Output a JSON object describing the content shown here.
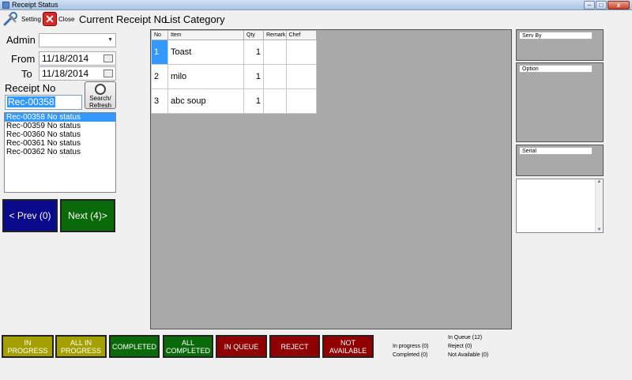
{
  "window": {
    "title": "Receipt Status"
  },
  "toolbar": {
    "setting_label": "Setting",
    "close_label": "Close",
    "current_receipt_label": "Current Receipt No",
    "list_category_label": "List Category"
  },
  "filter": {
    "admin_label": "Admin",
    "admin_value": "",
    "from_label": "From",
    "from_value": "11/18/2014",
    "to_label": "To",
    "to_value": "11/18/2014",
    "receipt_no_label": "Receipt No",
    "receipt_no_value": "Rec-00358",
    "search_label_1": "Search/",
    "search_label_2": "Refresh"
  },
  "receipts": [
    {
      "text": "Rec-00358 No status",
      "selected": true
    },
    {
      "text": "Rec-00359 No status",
      "selected": false
    },
    {
      "text": "Rec-00360 No status",
      "selected": false
    },
    {
      "text": "Rec-00361 No status",
      "selected": false
    },
    {
      "text": "Rec-00362 No status",
      "selected": false
    }
  ],
  "nav": {
    "prev_label": "< Prev (0)",
    "next_label": "Next (4)>"
  },
  "table": {
    "columns": [
      "No",
      "Item",
      "Qty",
      "Remark",
      "Chef"
    ],
    "rows": [
      {
        "no": "1",
        "item": "Toast",
        "qty": "1",
        "remark": "",
        "chef": ""
      },
      {
        "no": "2",
        "item": "milo",
        "qty": "1",
        "remark": "",
        "chef": ""
      },
      {
        "no": "3",
        "item": "abc soup",
        "qty": "1",
        "remark": "",
        "chef": ""
      }
    ]
  },
  "side": {
    "serv_by_label": "Serv By",
    "option_label": "Option",
    "serial_label": "Serial"
  },
  "status_buttons": {
    "in_progress": "IN PROGRESS",
    "all_in_progress_1": "ALL IN",
    "all_in_progress_2": "PROGRESS",
    "completed": "COMPLETED",
    "all_completed_1": "ALL",
    "all_completed_2": "COMPLETED",
    "in_queue": "IN QUEUE",
    "reject": "REJECT",
    "not_available_1": "NOT",
    "not_available_2": "AVAILABLE"
  },
  "stats": {
    "in_progress": "In progress (0)",
    "completed": "Completed (0)",
    "in_queue": "In Queue (12)",
    "reject": "Reject (0)",
    "not_available": "Not Available (0)"
  },
  "colors": {
    "prev_button": "#0a0a8c",
    "next_button": "#0a6a0a",
    "olive_button": "#a3a000",
    "green_button": "#0a6a0a",
    "red_button": "#900000",
    "selection": "#3399ff"
  }
}
